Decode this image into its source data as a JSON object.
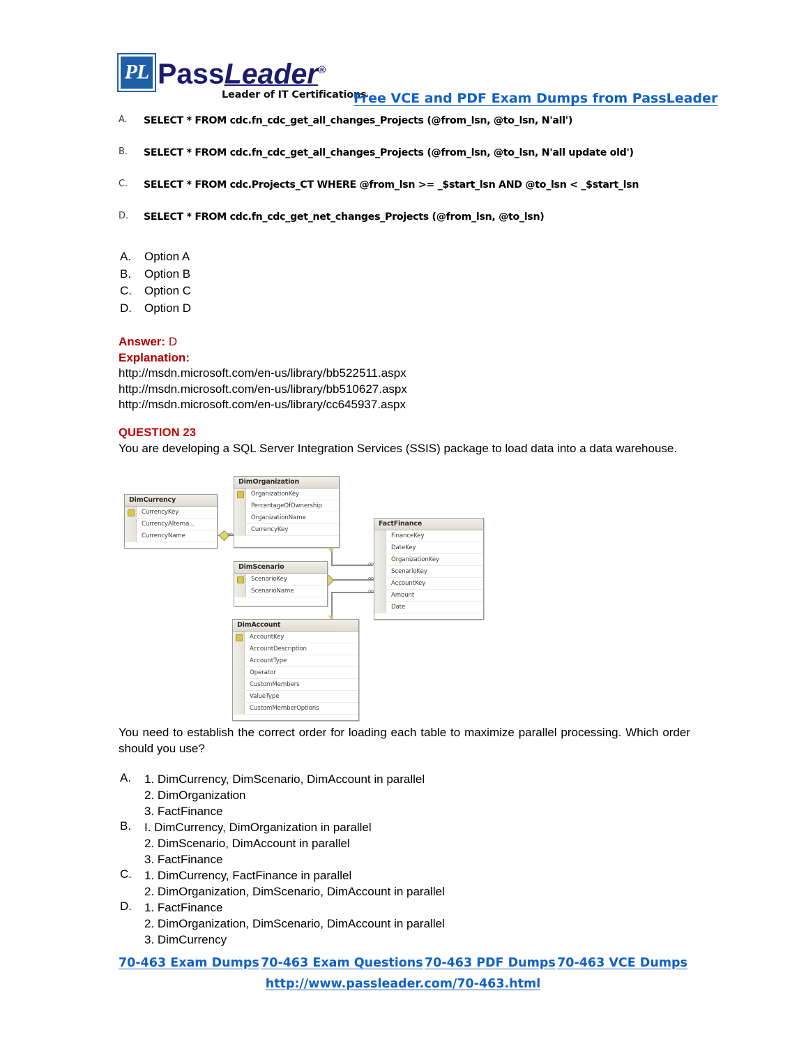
{
  "brand": {
    "logo_mark": "PL",
    "name_part1": "Pass",
    "name_part2": "Leader",
    "registered": "®",
    "tagline": "Leader of IT Certifications",
    "header_link": "Free VCE and PDF Exam Dumps from PassLeader",
    "logo_blue": "#1f5fa9",
    "wordmark_navy": "#1b1b6f",
    "link_blue": "#1161c4",
    "answer_red": "#b00000",
    "question_red": "#c00000"
  },
  "sql_options": [
    {
      "letter": "A.",
      "code": "SELECT * FROM cdc.fn_cdc_get_all_changes_Projects (@from_lsn, @to_lsn, N'all')"
    },
    {
      "letter": "B.",
      "code": "SELECT * FROM cdc.fn_cdc_get_all_changes_Projects (@from_lsn, @to_lsn, N'all update old')"
    },
    {
      "letter": "C.",
      "code": "SELECT * FROM cdc.Projects_CT WHERE @from_lsn >= _$start_lsn AND @to_lsn < _$start_lsn"
    },
    {
      "letter": "D.",
      "code": "SELECT * FROM cdc.fn_cdc_get_net_changes_Projects (@from_lsn, @to_lsn)"
    }
  ],
  "option_list": [
    {
      "letter": "A.",
      "text": "Option A"
    },
    {
      "letter": "B.",
      "text": "Option B"
    },
    {
      "letter": "C.",
      "text": "Option C"
    },
    {
      "letter": "D.",
      "text": "Option D"
    }
  ],
  "answer": {
    "label": "Answer:",
    "value": "D",
    "explanation_label": "Explanation:",
    "urls": [
      "http://msdn.microsoft.com/en-us/library/bb522511.aspx",
      "http://msdn.microsoft.com/en-us/library/bb510627.aspx",
      "http://msdn.microsoft.com/en-us/library/cc645937.aspx"
    ]
  },
  "question": {
    "heading": "QUESTION 23",
    "body": "You are developing a SQL Server Integration Services (SSIS) package to load data into a data warehouse.",
    "tail": "You need to establish the correct order for loading each table to maximize parallel processing. Which order should you use?"
  },
  "diagram": {
    "tables": [
      {
        "name": "DimCurrency",
        "fields": [
          "CurrencyKey",
          "CurrencyAlterna...",
          "CurrencyName"
        ],
        "key_field": "CurrencyKey"
      },
      {
        "name": "DimOrganization",
        "fields": [
          "OrganizationKey",
          "PercentageOfOwnership",
          "OrganizationName",
          "CurrencyKey"
        ],
        "key_field": "OrganizationKey"
      },
      {
        "name": "DimScenario",
        "fields": [
          "ScenarioKey",
          "ScenarioName"
        ],
        "key_field": "ScenarioKey"
      },
      {
        "name": "DimAccount",
        "fields": [
          "AccountKey",
          "AccountDescription",
          "AccountType",
          "Operator",
          "CustomMembers",
          "ValueType",
          "CustomMemberOptions"
        ],
        "key_field": "AccountKey"
      },
      {
        "name": "FactFinance",
        "fields": [
          "FinanceKey",
          "DateKey",
          "OrganizationKey",
          "ScenarioKey",
          "AccountKey",
          "Amount",
          "Date"
        ],
        "key_field": "FinanceKey"
      }
    ],
    "relationship_markers": [
      "oo",
      "oo",
      "oo"
    ]
  },
  "choices": [
    {
      "letter": "A.",
      "lines": [
        "1. DimCurrency, DimScenario, DimAccount in parallel",
        "2. DimOrganization",
        "3. FactFinance"
      ]
    },
    {
      "letter": "B.",
      "lines": [
        "I. DimCurrency, DimOrganization in parallel",
        "2. DimScenario, DimAccount in parallel",
        "3. FactFinance"
      ]
    },
    {
      "letter": "C.",
      "lines": [
        "1. DimCurrency, FactFinance in parallel",
        "2. DimOrganization, DimScenario, DimAccount in parallel"
      ]
    },
    {
      "letter": "D.",
      "lines": [
        "1. FactFinance",
        "2. DimOrganization, DimScenario, DimAccount in parallel",
        "3. DimCurrency"
      ]
    }
  ],
  "footer": {
    "links": [
      "70-463 Exam Dumps",
      "70-463 Exam Questions",
      "70-463 PDF Dumps",
      "70-463 VCE Dumps"
    ],
    "url": "http://www.passleader.com/70-463.html"
  }
}
